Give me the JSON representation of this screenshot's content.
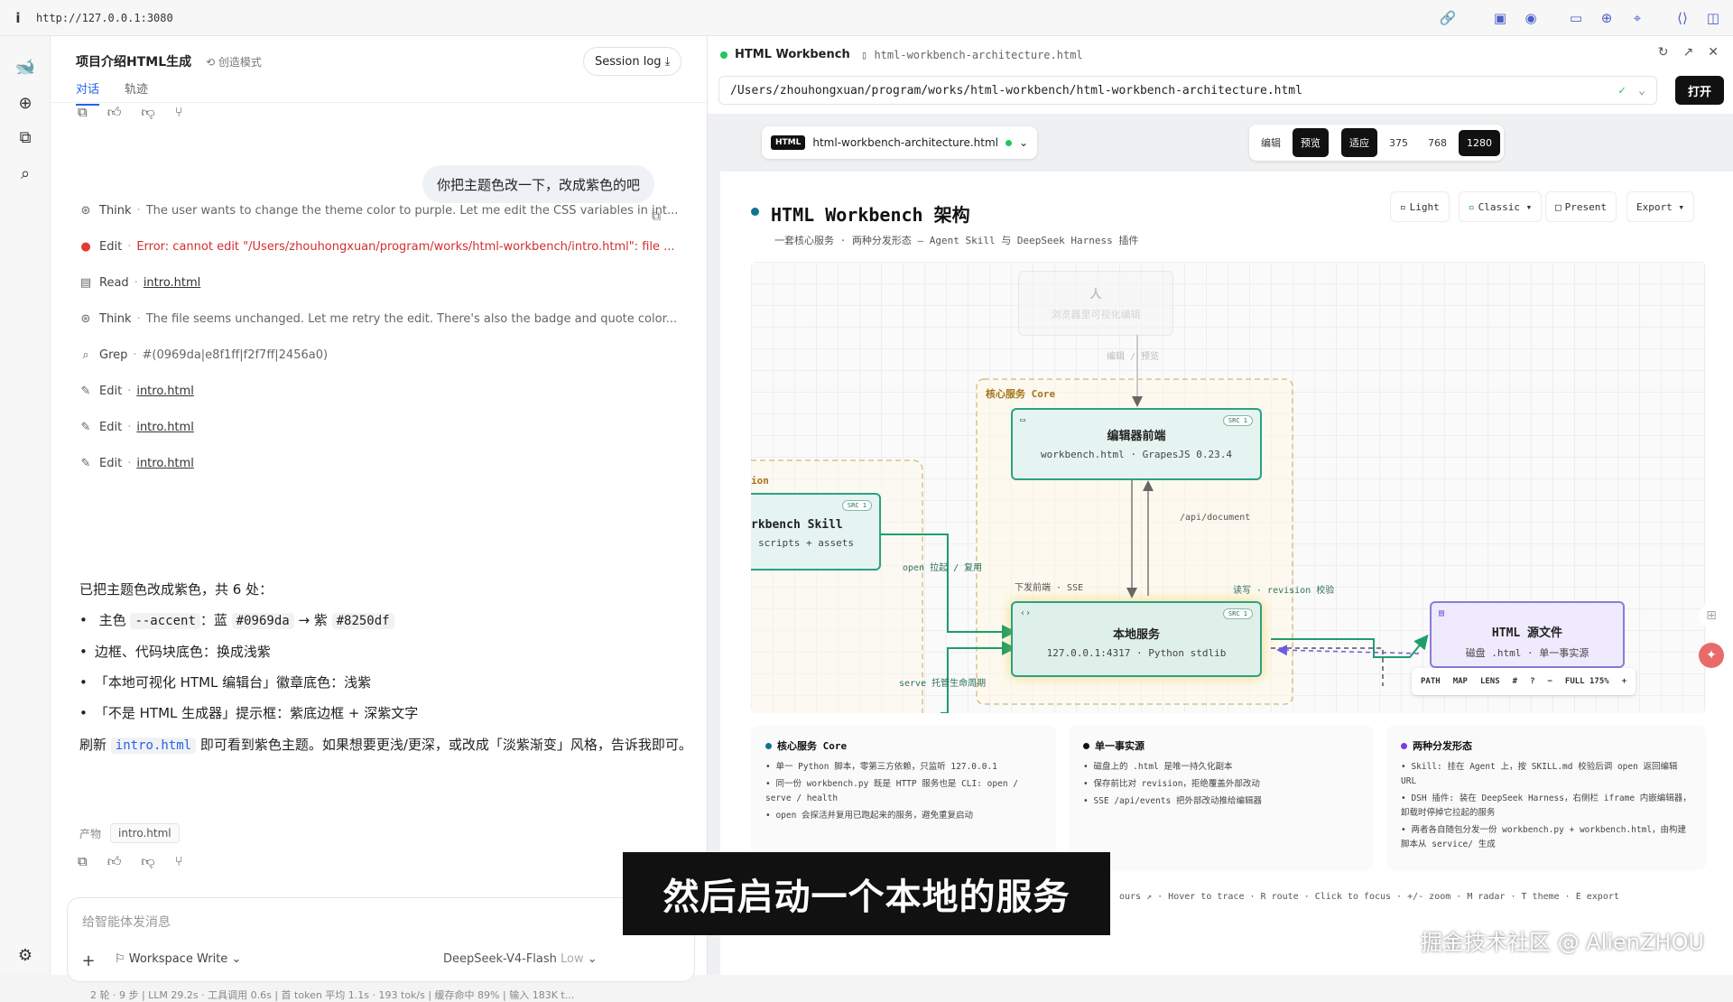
{
  "browser": {
    "url": "http://127.0.0.1:3080"
  },
  "chat": {
    "title": "项目介绍HTML生成",
    "mode": "创造模式",
    "session_log": "Session log",
    "tabs": [
      "对话",
      "轨迹"
    ],
    "user_message": "你把主题色改一下，改成紫色的吧",
    "steps": [
      {
        "kind": "Think",
        "detail": "The user wants to change the theme color to purple. Let me edit the CSS variables in int..."
      },
      {
        "kind": "Edit",
        "detail": "Error: cannot edit \"/Users/zhouhongxuan/program/works/html-workbench/intro.html\": file ..."
      },
      {
        "kind": "Read",
        "detail": "intro.html"
      },
      {
        "kind": "Think",
        "detail": "The file seems unchanged. Let me retry the edit. There's also the badge and quote color..."
      },
      {
        "kind": "Grep",
        "detail": "#(0969da|e8f1ff|f2f7ff|2456a0)"
      },
      {
        "kind": "Edit",
        "detail": "intro.html"
      },
      {
        "kind": "Edit",
        "detail": "intro.html"
      },
      {
        "kind": "Edit",
        "detail": "intro.html"
      }
    ],
    "summary_title": "已把主题色改成紫色，共 6 处：",
    "bullet1_a": "主色",
    "bullet1_code1": "--accent",
    "bullet1_b": "：蓝",
    "bullet1_code2": "#0969da",
    "bullet1_c": "→ 紫",
    "bullet1_code3": "#8250df",
    "bullet2": "边框、代码块底色：换成浅紫",
    "bullet3": "「本地可视化 HTML 编辑台」徽章底色：浅紫",
    "bullet4": "「不是 HTML 生成器」提示框：紫底边框 + 深紫文字",
    "refresh_a": "刷新",
    "refresh_code": "intro.html",
    "refresh_b": "即可看到紫色主题。如果想要更浅/更深，或改成「淡紫渐变」风格，告诉我即可。",
    "artifact_label": "产物",
    "artifact_file": "intro.html",
    "composer_placeholder": "给智能体发消息",
    "workspace": "Workspace Write",
    "model": "DeepSeek-V4-Flash",
    "model_effort": "Low",
    "status": "2 轮 · 9 步  |  LLM 29.2s · 工具调用 0.6s  |  首 token 平均 1.1s · 193 tok/s  |  缓存命中 89%  |  输入 183K t..."
  },
  "workbench": {
    "title": "HTML Workbench",
    "file": "html-workbench-architecture.html",
    "path": "/Users/zhouhongxuan/program/works/html-workbench/html-workbench-architecture.html",
    "open_label": "打开",
    "pill_tag": "HTML",
    "pill_file": "html-workbench-architecture.html",
    "view_buttons": [
      "编辑",
      "预览",
      "适应",
      "375",
      "768",
      "1280"
    ],
    "doc": {
      "title": "HTML Workbench 架构",
      "subtitle": "一套核心服务 · 两种分发形态 — Agent Skill 与 DeepSeek Harness 插件",
      "buttons": [
        "Light",
        "Classic ▾",
        "Present",
        "Export ▾"
      ],
      "diagram": {
        "human_title": "人",
        "human_sub": "浏览器里可视化编辑",
        "human_edge": "编辑 / 预览",
        "core_label": "核心服务 Core",
        "left_label": "ion",
        "editor_title": "编辑器前端",
        "editor_sub": "workbench.html · GrapesJS 0.23.4",
        "server_title": "本地服务",
        "server_sub": "127.0.0.1:4317 · Python stdlib",
        "skill_title": "rkbench Skill",
        "skill_sub": "scripts + assets",
        "html_title": "HTML 源文件",
        "html_sub": "磁盘 .html · 单一事实源",
        "src_badge": "SRC 1",
        "e_api": "/api/document",
        "e_sse": "下发前端 · SSE",
        "e_rev": "读写 · revision 校验",
        "e_open": "open 拉起 / 复用",
        "e_serve": "serve 托管生命周期",
        "lens": [
          "PATH",
          "MAP",
          "LENS",
          "#",
          "?",
          "−",
          "FULL 175%",
          "+"
        ]
      },
      "cards": [
        {
          "title": "核心服务 Core",
          "color": "#0e7490",
          "items": [
            "单一 Python 脚本，零第三方依赖，只监听 127.0.0.1",
            "同一份 workbench.py 既是 HTTP 服务也是 CLI: open / serve / health",
            "open 会探活并复用已跑起来的服务，避免重复启动"
          ]
        },
        {
          "title": "单一事实源",
          "color": "#111111",
          "items": [
            "磁盘上的 .html 是唯一持久化副本",
            "保存前比对 revision，拒绝覆盖外部改动",
            "SSE /api/events 把外部改动推给编辑器"
          ]
        },
        {
          "title": "两种分发形态",
          "color": "#7c3aed",
          "items": [
            "Skill: 挂在 Agent 上，按 SKILL.md 校验后调 open 返回编辑 URL",
            "DSH 插件: 装在 DeepSeek Harness，右侧栏 iframe 内嵌编辑器，卸载时停掉它拉起的服务",
            "两者各自随包分发一份 workbench.py + workbench.html，由构建脚本从 service/ 生成"
          ]
        }
      ],
      "hint": "ours ↗ · Hover to trace · R route · Click to focus · +/- zoom · M radar · T theme · E export"
    }
  },
  "overlay": {
    "subtitle": "然后启动一个本地的服务",
    "watermark": "掘金技术社区 @ AlienZHOU"
  }
}
